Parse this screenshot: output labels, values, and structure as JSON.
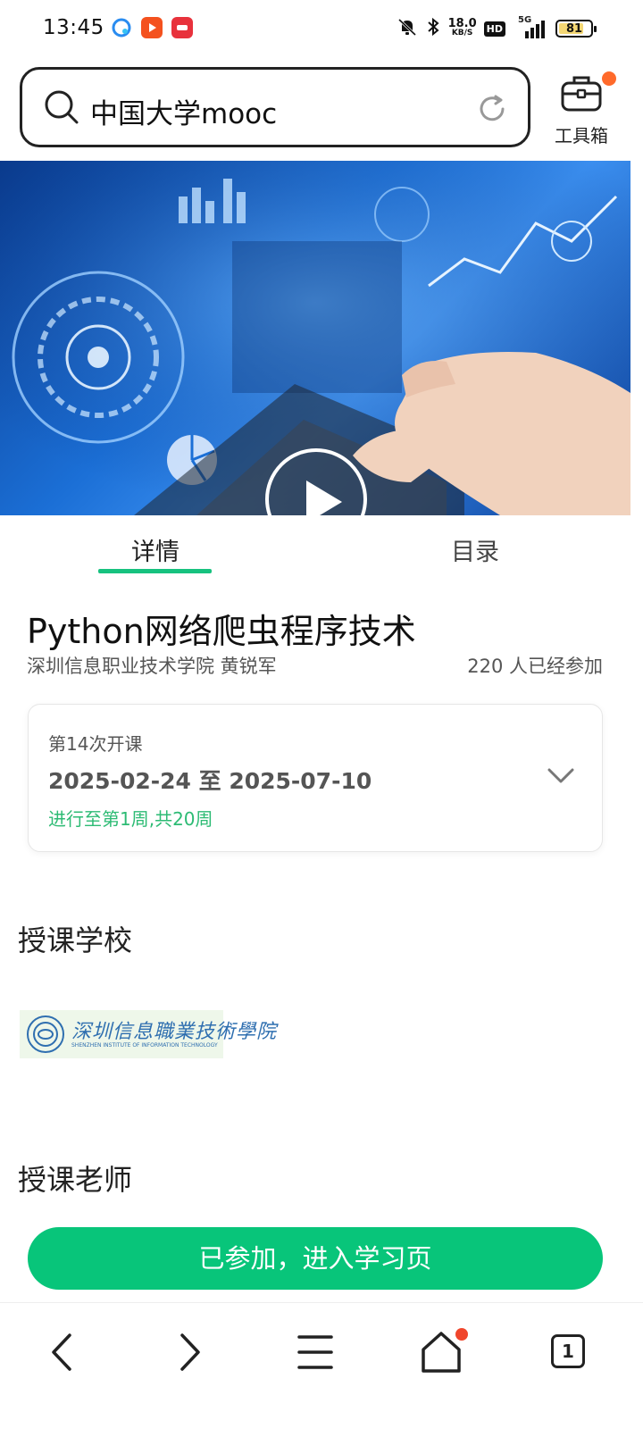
{
  "status_bar": {
    "time": "13:45",
    "net_speed_value": "18.0",
    "net_speed_unit": "KB/S",
    "hd_label": "HD",
    "network_type": "5G",
    "battery_level": "81"
  },
  "search": {
    "query": "中国大学mooc"
  },
  "toolbox": {
    "label": "工具箱"
  },
  "tabs": [
    {
      "label": "详情",
      "active": true
    },
    {
      "label": "目录",
      "active": false
    }
  ],
  "course": {
    "title": "Python网络爬虫程序技术",
    "school_teacher": "深圳信息职业技术学院 黄锐军",
    "participants": "220 人已经参加"
  },
  "session": {
    "label": "第14次开课",
    "dates": "2025-02-24 至 2025-07-10",
    "progress": "进行至第1周,共20周"
  },
  "sections": {
    "school": "授课学校",
    "teacher": "授课老师"
  },
  "school_logo": {
    "name_cn": "深圳信息職業技術學院",
    "name_en": "SHENZHEN INSTITUTE OF INFORMATION TECHNOLOGY"
  },
  "cta": {
    "label": "已参加，进入学习页"
  },
  "bottom_nav": {
    "tab_count": "1"
  },
  "colors": {
    "accent_green": "#08c57a",
    "progress_green": "#2dbb74",
    "notification_red": "#f0462c",
    "toolbox_dot": "#ff6a2b"
  }
}
